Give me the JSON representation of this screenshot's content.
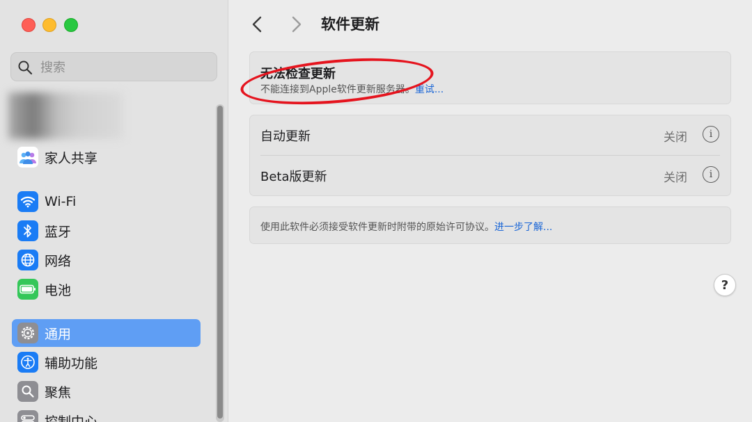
{
  "window": {
    "title": "软件更新"
  },
  "sidebar": {
    "search_placeholder": "搜索",
    "items": [
      {
        "label": "家人共享",
        "icon": "family-sharing-icon"
      },
      {
        "label": "Wi-Fi",
        "icon": "wifi-icon"
      },
      {
        "label": "蓝牙",
        "icon": "bluetooth-icon"
      },
      {
        "label": "网络",
        "icon": "network-icon"
      },
      {
        "label": "电池",
        "icon": "battery-icon"
      },
      {
        "label": "通用",
        "icon": "gear-icon",
        "selected": true
      },
      {
        "label": "辅助功能",
        "icon": "accessibility-icon"
      },
      {
        "label": "聚焦",
        "icon": "spotlight-icon"
      },
      {
        "label": "控制中心",
        "icon": "control-center-icon"
      }
    ]
  },
  "main": {
    "status": {
      "title": "无法检查更新",
      "subtitle": "不能连接到Apple软件更新服务器。",
      "retry_link": "重试..."
    },
    "settings": [
      {
        "label": "自动更新",
        "value": "关闭"
      },
      {
        "label": "Beta版更新",
        "value": "关闭"
      }
    ],
    "license": {
      "text": "使用此软件必须接受软件更新时附带的原始许可协议。",
      "link": "进一步了解..."
    },
    "help_label": "?"
  },
  "colors": {
    "accent": "#5f9ef4",
    "link": "#1965d6",
    "annotation": "#e5141e"
  }
}
